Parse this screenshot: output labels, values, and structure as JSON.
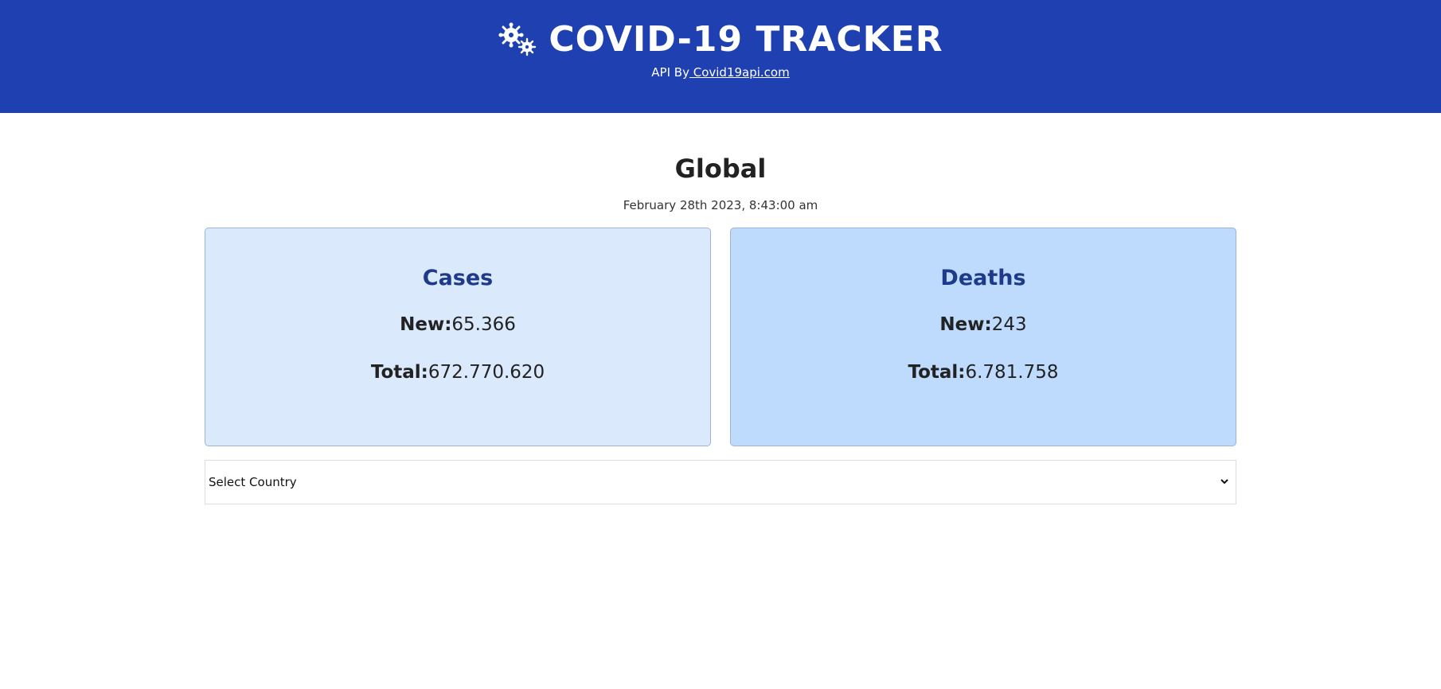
{
  "header": {
    "title": "COVID-19 TRACKER",
    "api_prefix": "API By",
    "api_link": " Covid19api.com",
    "logo_icon": "virus-icon",
    "bg_color": "#1f40b0"
  },
  "main": {
    "scope_title": "Global",
    "date": "February 28th 2023, 8:43:00 am",
    "cards": {
      "cases": {
        "title": "Cases",
        "new_label": "New:",
        "new_value": "65.366",
        "total_label": "Total:",
        "total_value": "672.770.620",
        "bg_color": "#dbe9fd"
      },
      "deaths": {
        "title": "Deaths",
        "new_label": "New:",
        "new_value": "243",
        "total_label": "Total:",
        "total_value": "6.781.758",
        "bg_color": "#bedafc"
      }
    },
    "country_select": {
      "selected": "Select Country",
      "icon": "chevron-down-icon"
    }
  }
}
